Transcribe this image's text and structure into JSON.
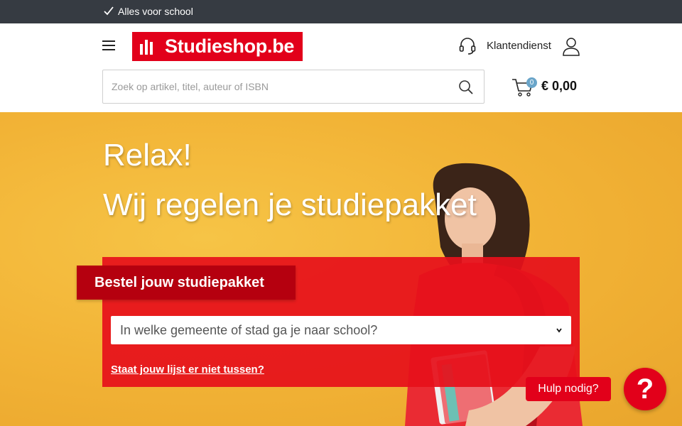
{
  "topbar": {
    "text": "Alles voor school",
    "icon": "check-icon"
  },
  "header": {
    "logo_text": "Studieshop.be",
    "support_label": "Klantendienst",
    "search_placeholder": "Zoek op artikel, titel, auteur of ISBN",
    "cart_count": "0",
    "cart_total": "€ 0,00"
  },
  "hero": {
    "title_1": "Relax!",
    "title_2": "Wij regelen je studiepakket",
    "order_tab": "Bestel jouw studiepakket",
    "select_placeholder": "In welke gemeente of stad ga je naar school?",
    "missing_link": "Staat jouw lijst er niet tussen?"
  },
  "help": {
    "bubble_label": "Hulp nodig?",
    "button_label": "?"
  },
  "colors": {
    "brand_red": "#e2001a",
    "topbar": "#363b42",
    "hero_bg": "#f2b336",
    "badge": "#6aa5c9"
  }
}
